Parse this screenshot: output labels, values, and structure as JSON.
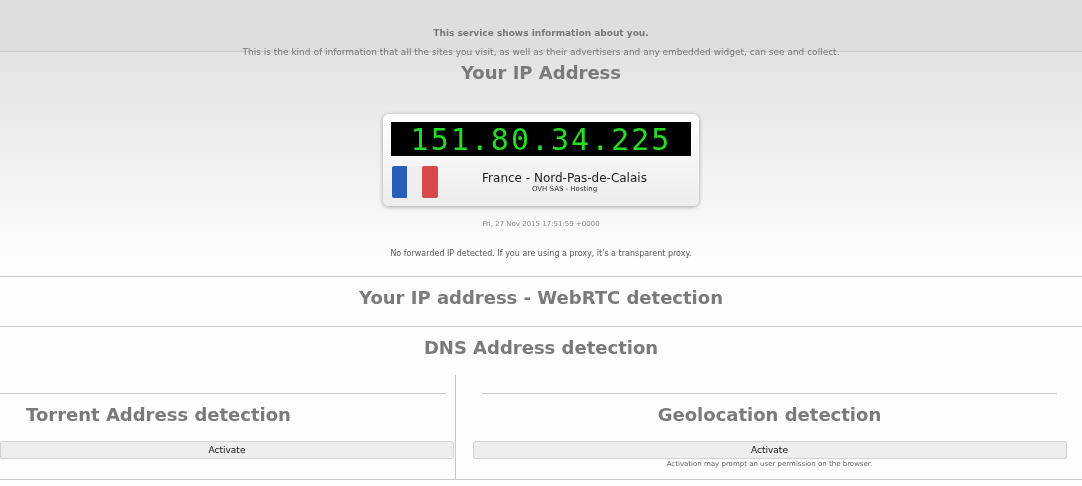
{
  "notice": {
    "title": "This service shows information about you.",
    "text": "This is the kind of information that all the sites you visit, as well as their advertisers and any embedded widget, can see and collect."
  },
  "ip_section": {
    "title": "Your IP Address",
    "ip": "151.80.34.225",
    "location": "France - Nord-Pas-de-Calais",
    "isp": "OVH SAS - Hosting",
    "timestamp": "Fri, 27 Nov 2015 17:51:59 +0000",
    "proxy_note": "No forwarded IP detected. If you are using a proxy, it's a transparent proxy."
  },
  "sections": [
    {
      "title": "Your IP address - WebRTC detection"
    },
    {
      "title": "DNS Address detection"
    }
  ],
  "columns": [
    {
      "title": "Torrent Address detection",
      "button": "Activate"
    },
    {
      "title": "Geolocation detection",
      "button": "Activate",
      "note": "Activation may prompt an user permission on the browser."
    }
  ]
}
